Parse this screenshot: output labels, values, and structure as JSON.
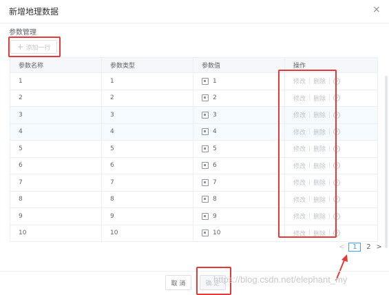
{
  "dialog": {
    "title": "新增地理数据",
    "close": "×"
  },
  "section": {
    "label": "参数管理",
    "add_row": "添加一行"
  },
  "table": {
    "headers": [
      "参数名称",
      "参数类型",
      "参数值",
      "操作"
    ],
    "rows": [
      {
        "name": "1",
        "type": "1",
        "value": "1"
      },
      {
        "name": "2",
        "type": "2",
        "value": "2"
      },
      {
        "name": "3",
        "type": "3",
        "value": "3"
      },
      {
        "name": "4",
        "type": "4",
        "value": "4"
      },
      {
        "name": "5",
        "type": "5",
        "value": "5"
      },
      {
        "name": "6",
        "type": "6",
        "value": "6"
      },
      {
        "name": "7",
        "type": "7",
        "value": "7"
      },
      {
        "name": "8",
        "type": "8",
        "value": "8"
      },
      {
        "name": "9",
        "type": "9",
        "value": "9"
      },
      {
        "name": "10",
        "type": "10",
        "value": "10"
      }
    ],
    "op_edit": "修改",
    "op_delete": "删除"
  },
  "pagination": {
    "prev": "<",
    "pages": [
      "1",
      "2"
    ],
    "active_page": "1",
    "next": ">"
  },
  "footer": {
    "cancel": "取 消",
    "confirm": "确 定"
  },
  "watermark": "https://blog.csdn.net/elephant_my",
  "colors": {
    "highlight": "#e53935",
    "accent": "#409eff"
  }
}
